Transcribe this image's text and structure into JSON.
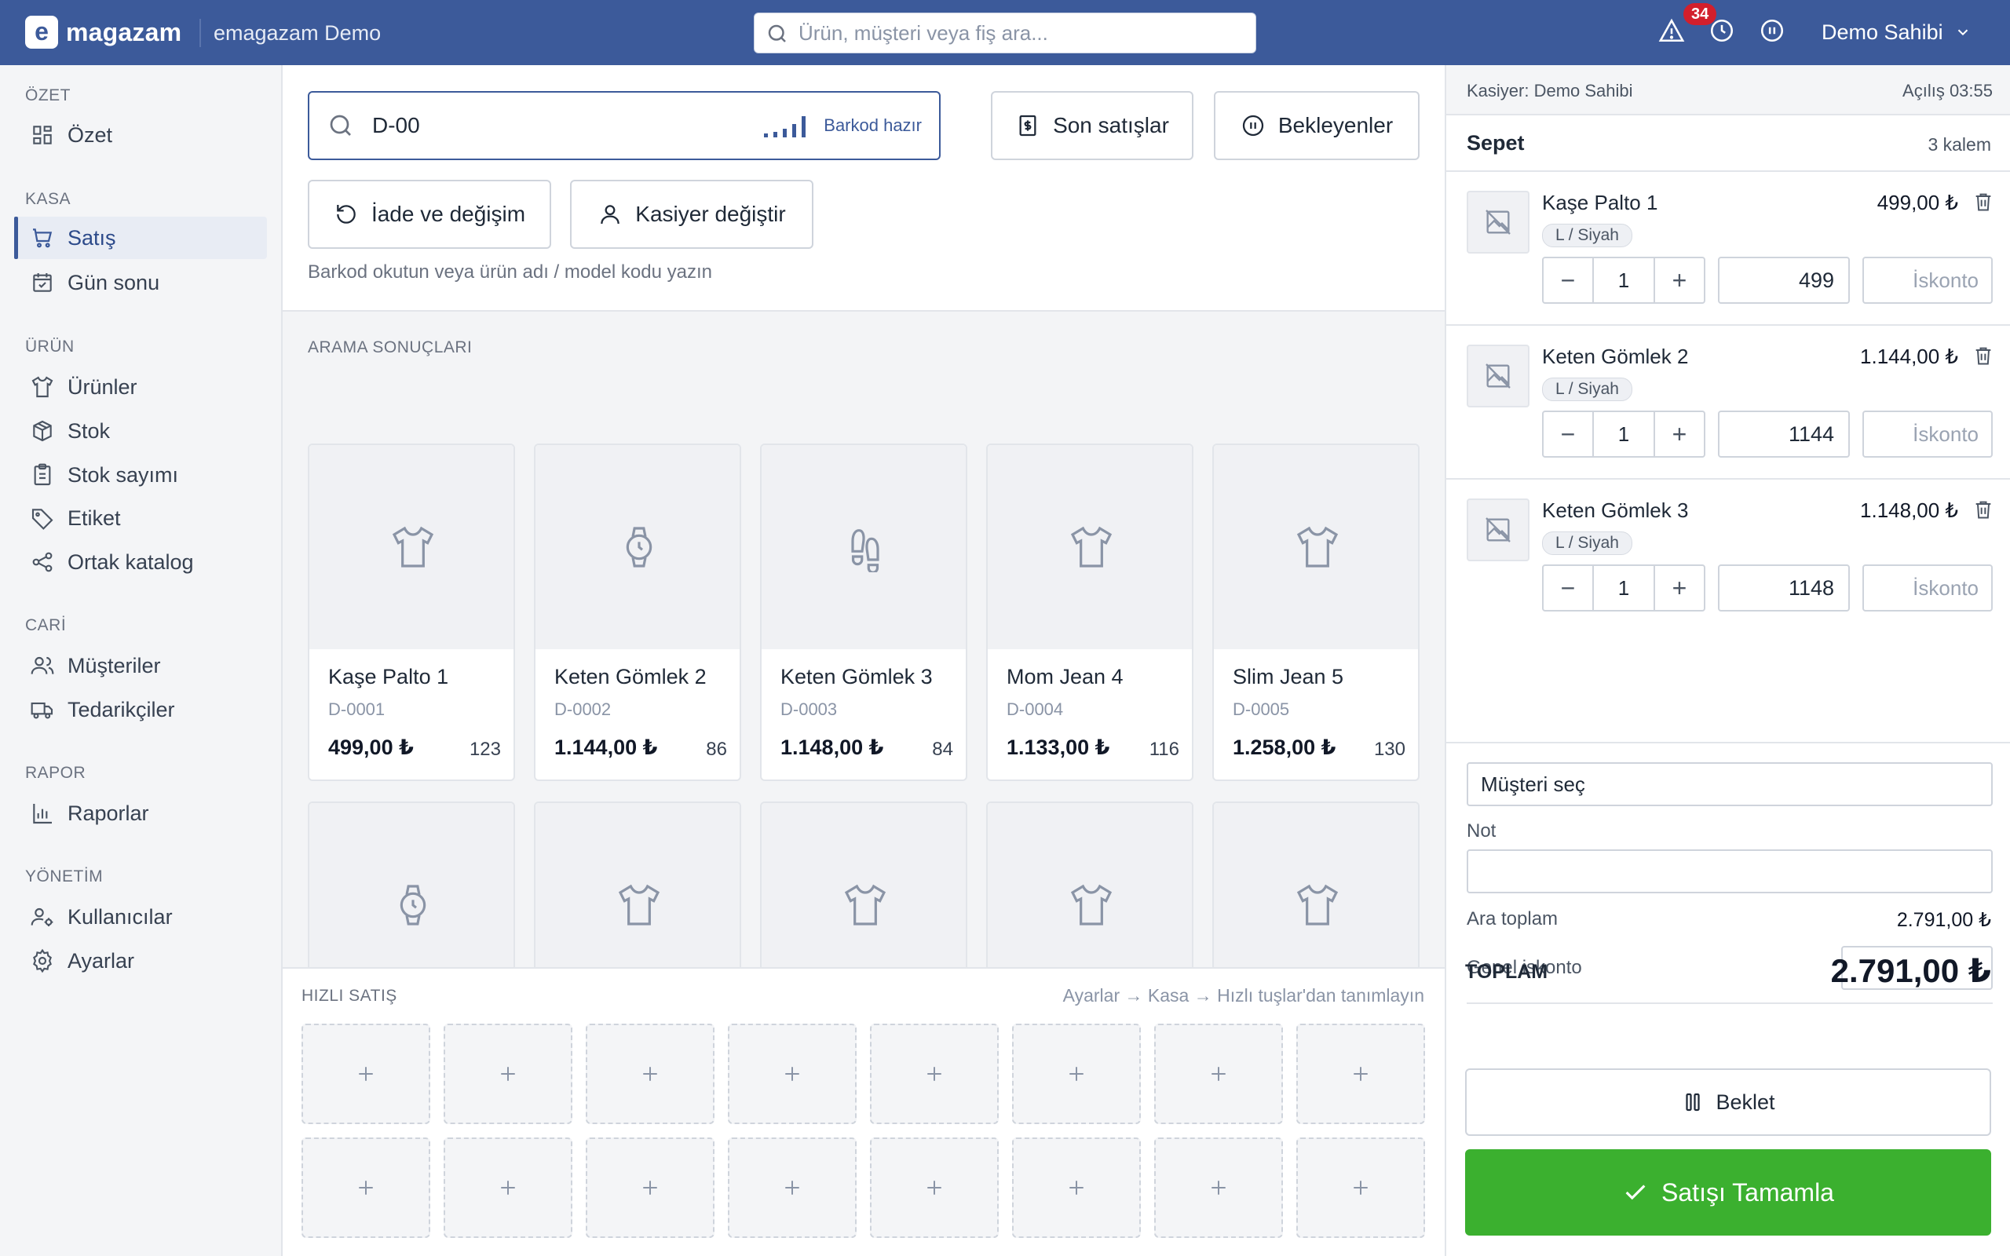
{
  "header": {
    "logo_letter": "e",
    "logo_text": "magazam",
    "store_name": "emagazam Demo",
    "search_placeholder": "Ürün, müşteri veya fiş ara...",
    "notification_count": "34",
    "user_name": "Demo Sahibi"
  },
  "sidebar": {
    "sections": [
      {
        "title": "ÖZET",
        "items": [
          {
            "label": "Özet",
            "icon": "grid-icon"
          }
        ]
      },
      {
        "title": "KASA",
        "items": [
          {
            "label": "Satış",
            "icon": "cart-icon",
            "active": true
          },
          {
            "label": "Gün sonu",
            "icon": "calendar-check-icon"
          }
        ]
      },
      {
        "title": "ÜRÜN",
        "items": [
          {
            "label": "Ürünler",
            "icon": "shirt-icon"
          },
          {
            "label": "Stok",
            "icon": "box-icon"
          },
          {
            "label": "Stok sayımı",
            "icon": "clipboard-icon"
          },
          {
            "label": "Etiket",
            "icon": "tag-icon"
          },
          {
            "label": "Ortak katalog",
            "icon": "share-icon"
          }
        ]
      },
      {
        "title": "CARİ",
        "items": [
          {
            "label": "Müşteriler",
            "icon": "users-icon"
          },
          {
            "label": "Tedarikçiler",
            "icon": "truck-icon"
          }
        ]
      },
      {
        "title": "RAPOR",
        "items": [
          {
            "label": "Raporlar",
            "icon": "bar-chart-icon"
          }
        ]
      },
      {
        "title": "YÖNETİM",
        "items": [
          {
            "label": "Kullanıcılar",
            "icon": "user-cog-icon"
          },
          {
            "label": "Ayarlar",
            "icon": "gear-icon"
          }
        ]
      }
    ]
  },
  "sale": {
    "barcode_value": "D-00",
    "barcode_status": "Barkod hazır",
    "recent_sales_label": "Son satışlar",
    "pending_label": "Bekleyenler",
    "return_label": "İade ve değişim",
    "switch_cashier_label": "Kasiyer değiştir",
    "hint": "Barkod okutun veya ürün adı / model kodu yazın"
  },
  "results": {
    "title": "ARAMA SONUÇLARI",
    "products": [
      {
        "name": "Kaşe Palto 1",
        "code": "D-0001",
        "price": "499,00 ₺",
        "stock": "123",
        "icon": "shirt-icon"
      },
      {
        "name": "Keten Gömlek 2",
        "code": "D-0002",
        "price": "1.144,00 ₺",
        "stock": "86",
        "icon": "watch-icon"
      },
      {
        "name": "Keten Gömlek 3",
        "code": "D-0003",
        "price": "1.148,00 ₺",
        "stock": "84",
        "icon": "footprints-icon"
      },
      {
        "name": "Mom Jean 4",
        "code": "D-0004",
        "price": "1.133,00 ₺",
        "stock": "116",
        "icon": "shirt-icon"
      },
      {
        "name": "Slim Jean 5",
        "code": "D-0005",
        "price": "1.258,00 ₺",
        "stock": "130",
        "icon": "shirt-icon"
      }
    ],
    "second_row_icons": [
      "watch-icon",
      "shirt-icon",
      "shirt-icon",
      "shirt-icon",
      "shirt-icon"
    ]
  },
  "quick_sale": {
    "title": "HIZLI SATIŞ",
    "hint": "Ayarlar → Kasa → Hızlı tuşlar'dan tanımlayın",
    "slot_count": 16
  },
  "cart": {
    "cashier": "Kasiyer: Demo Sahibi",
    "opening": "Açılış 03:55",
    "title": "Sepet",
    "count": "3 kalem",
    "items": [
      {
        "name": "Kaşe Palto 1",
        "price": "499,00 ₺",
        "variant": "L / Siyah",
        "qty": "1",
        "unit_price": "499",
        "discount_placeholder": "İskonto"
      },
      {
        "name": "Keten Gömlek 2",
        "price": "1.144,00 ₺",
        "variant": "L / Siyah",
        "qty": "1",
        "unit_price": "1144",
        "discount_placeholder": "İskonto"
      },
      {
        "name": "Keten Gömlek 3",
        "price": "1.148,00 ₺",
        "variant": "L / Siyah",
        "qty": "1",
        "unit_price": "1148",
        "discount_placeholder": "İskonto"
      }
    ],
    "customer_select": "Müşteri seç",
    "note_label": "Not",
    "subtotal_label": "Ara toplam",
    "subtotal_value": "2.791,00 ₺",
    "general_discount_label": "Genel iskonto",
    "total_label": "TOPLAM",
    "total_value": "2.791,00 ₺",
    "hold_label": "Beklet",
    "complete_label": "Satışı Tamamla"
  },
  "colors": {
    "brand": "#3c5a9a",
    "success": "#3bb02f",
    "danger": "#d21f2c"
  }
}
